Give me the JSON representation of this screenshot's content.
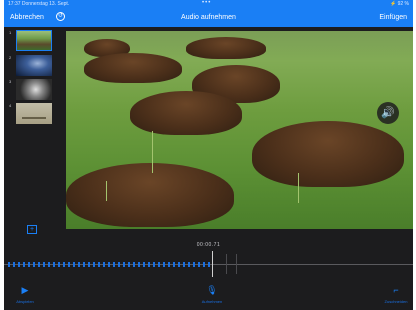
{
  "status_bar": {
    "left": "17:37  Donnerstag 13. Sept.",
    "center": "•••",
    "right": "⚡ 92 %"
  },
  "nav": {
    "cancel": "Abbrechen",
    "history_icon": "clock-icon",
    "title": "Audio aufnehmen",
    "insert": "Einfügen"
  },
  "slides": [
    {
      "number": "1",
      "thumb": "molehills-thumbnail",
      "selected": true
    },
    {
      "number": "2",
      "thumb": "night-sky-thumbnail",
      "selected": false
    },
    {
      "number": "3",
      "thumb": "disc-thumbnail",
      "selected": false
    },
    {
      "number": "4",
      "thumb": "map-thumbnail",
      "selected": false
    }
  ],
  "add_slide_icon": "add-slide-icon",
  "speaker_icon": "speaker-icon",
  "timeline": {
    "time": "00:00.71"
  },
  "toolbar": {
    "play": {
      "label": "Abspielen",
      "icon": "play-icon"
    },
    "record": {
      "label": "Aufnehmen",
      "icon": "microphone-icon"
    },
    "trim": {
      "label": "Zuschneiden",
      "icon": "crop-icon"
    }
  },
  "colors": {
    "accent": "#1a7ff5",
    "background": "#1c1c1e"
  }
}
